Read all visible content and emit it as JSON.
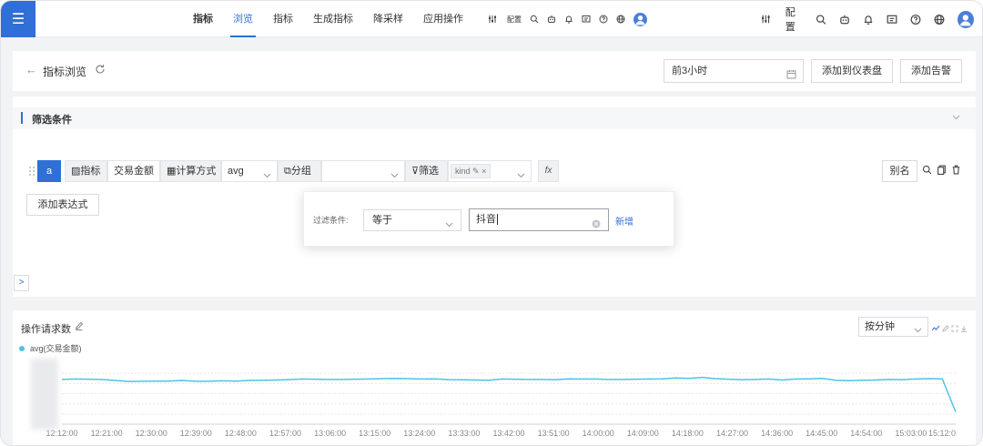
{
  "topbar": {
    "menu_icon": "menu-icon",
    "nav": [
      {
        "label": "指标",
        "bold": true,
        "active": false
      },
      {
        "label": "浏览",
        "bold": false,
        "active": true
      },
      {
        "label": "指标",
        "bold": false,
        "active": false
      },
      {
        "label": "生成指标",
        "bold": false,
        "active": false
      },
      {
        "label": "降采样",
        "bold": false,
        "active": false
      },
      {
        "label": "应用操作",
        "bold": false,
        "active": false
      }
    ],
    "config_label": "配置",
    "icons": [
      "config-icon",
      "search-icon",
      "robot-icon",
      "bell-icon",
      "message-icon",
      "help-icon",
      "globe-icon",
      "avatar"
    ]
  },
  "header": {
    "title": "指标浏览",
    "time_range": "前3小时",
    "add_dashboard": "添加到仪表盘",
    "add_alert": "添加告警"
  },
  "filter_panel": {
    "title": "筛选条件",
    "expression": {
      "var": "a",
      "metric_label": "指标",
      "metric_value": "交易金额",
      "calc_label": "计算方式",
      "calc_value": "avg",
      "group_label": "分组",
      "group_value": "",
      "filter_label": "筛选",
      "filter_tag": "kind",
      "fx": "fx",
      "alias": "别名"
    },
    "add_expression": "添加表达式"
  },
  "popover": {
    "condition_label": "过滤条件:",
    "operator": "等于",
    "value": "抖音",
    "add_link": "新增"
  },
  "chart_panel": {
    "title": "操作请求数",
    "granularity": "按分钟",
    "colors": {
      "line": "#4cc3e8",
      "grid": "#e6e8eb",
      "axis_text": "#888888"
    }
  },
  "chart_data": {
    "type": "line",
    "title": "操作请求数",
    "series": [
      {
        "name": "avg(交易金额)",
        "values": [
          2.2,
          2.22,
          2.21,
          2.2,
          2.15,
          2.1,
          2.11,
          2.12,
          2.12,
          2.15,
          2.11,
          2.11,
          2.13,
          2.12,
          2.15,
          2.16,
          2.17,
          2.19,
          2.22,
          2.21,
          2.2,
          2.2,
          2.21,
          2.22,
          2.24,
          2.25,
          2.24,
          2.22,
          2.23,
          2.19,
          2.18,
          2.17,
          2.16,
          2.22,
          2.21,
          2.2,
          2.2,
          2.19,
          2.23,
          2.22,
          2.22,
          2.2,
          2.2,
          2.21,
          2.22,
          2.23,
          2.27,
          2.25,
          2.3,
          2.24,
          2.21,
          2.19,
          2.2,
          2.22,
          2.17,
          2.22,
          2.23,
          2.25,
          2.16,
          2.14,
          2.16,
          2.17,
          2.2,
          2.19,
          2.22,
          2.24,
          2.23,
          0.6
        ]
      }
    ],
    "x": [
      "12:12:00",
      "12:21:00",
      "12:30:00",
      "12:39:00",
      "12:48:00",
      "12:57:00",
      "13:06:00",
      "13:15:00",
      "13:24:00",
      "13:33:00",
      "13:42:00",
      "13:51:00",
      "14:00:00",
      "14:09:00",
      "14:18:00",
      "14:27:00",
      "14:36:00",
      "14:45:00",
      "14:54:00",
      "15:03:00",
      "15:12:0"
    ],
    "ylim": [
      0,
      3
    ],
    "grid": true,
    "legend_position": "top-left"
  }
}
